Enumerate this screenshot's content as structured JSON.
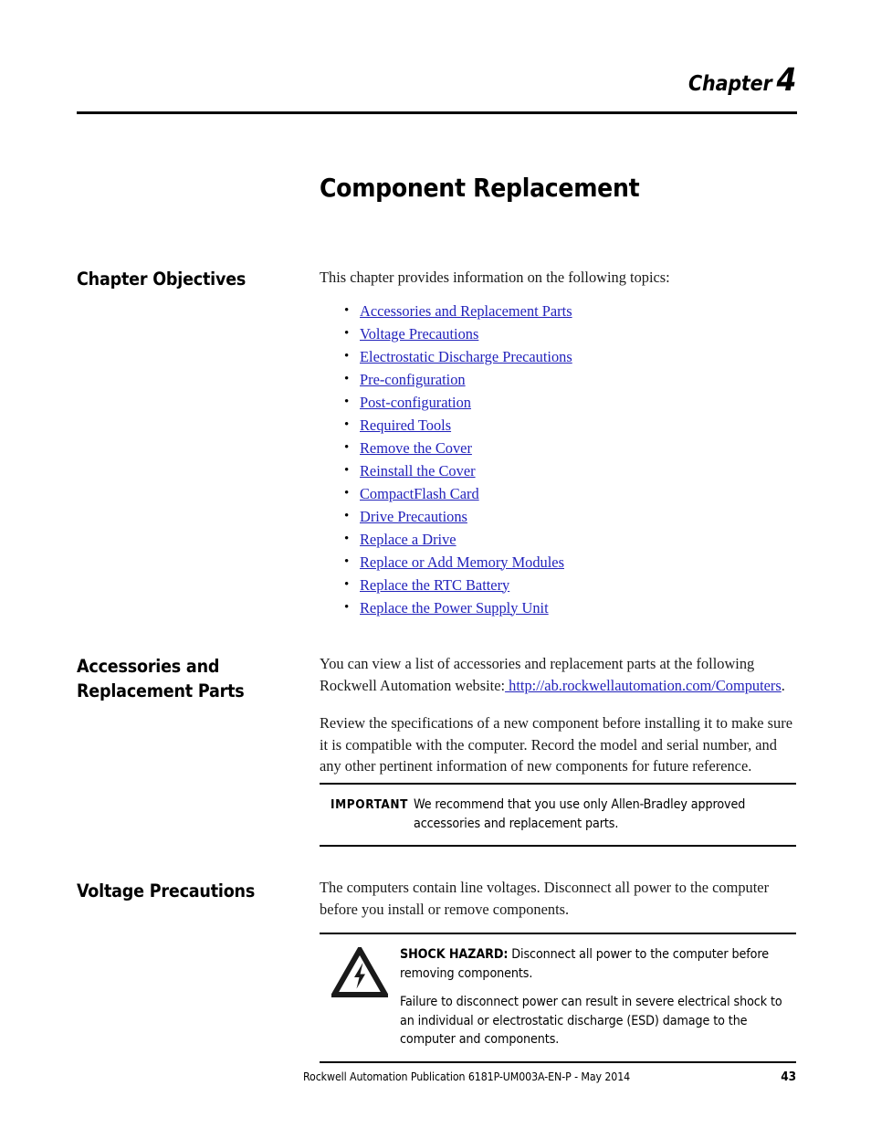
{
  "header": {
    "chapter_word": "Chapter",
    "chapter_number": "4"
  },
  "title": "Component Replacement",
  "sections": {
    "objectives": {
      "heading": "Chapter Objectives",
      "intro": "This chapter provides information on the following topics:",
      "topics": [
        "Accessories and Replacement Parts",
        "Voltage Precautions",
        "Electrostatic Discharge Precautions",
        "Pre-configuration",
        "Post-configuration",
        "Required Tools",
        "Remove the Cover",
        "Reinstall the Cover",
        "CompactFlash Card",
        "Drive Precautions",
        "Replace a Drive",
        "Replace or Add Memory Modules",
        "Replace the RTC Battery",
        "Replace the Power Supply Unit"
      ]
    },
    "accessories": {
      "heading": "Accessories and Replacement Parts",
      "para1_before_link": "You can view a list of accessories and replacement parts at the following Rockwell Automation website:",
      "link_text": " http://ab.rockwellautomation.com/Computers",
      "para1_after_link": ".",
      "para2": "Review the specifications of a new component before installing it to make sure it is compatible with the computer. Record the model and serial number, and any other pertinent information of new components for future reference.",
      "important": {
        "label": "IMPORTANT",
        "text": "We recommend that you use only Allen-Bradley approved accessories and replacement parts."
      }
    },
    "voltage": {
      "heading": "Voltage Precautions",
      "para1": "The computers contain line voltages. Disconnect all power to the computer before you install or remove components.",
      "hazard": {
        "lead_in": "SHOCK HAZARD:",
        "line1": " Disconnect all power to the computer before removing components.",
        "line2": "Failure to disconnect power can result in severe electrical shock to an individual or electrostatic discharge (ESD) damage to the computer and components."
      }
    }
  },
  "footer": {
    "publication": "Rockwell Automation Publication 6181P-UM003A-EN-P - May 2014",
    "page_number": "43"
  },
  "colors": {
    "link": "#2222bb",
    "text": "#000000",
    "rule": "#000000"
  }
}
